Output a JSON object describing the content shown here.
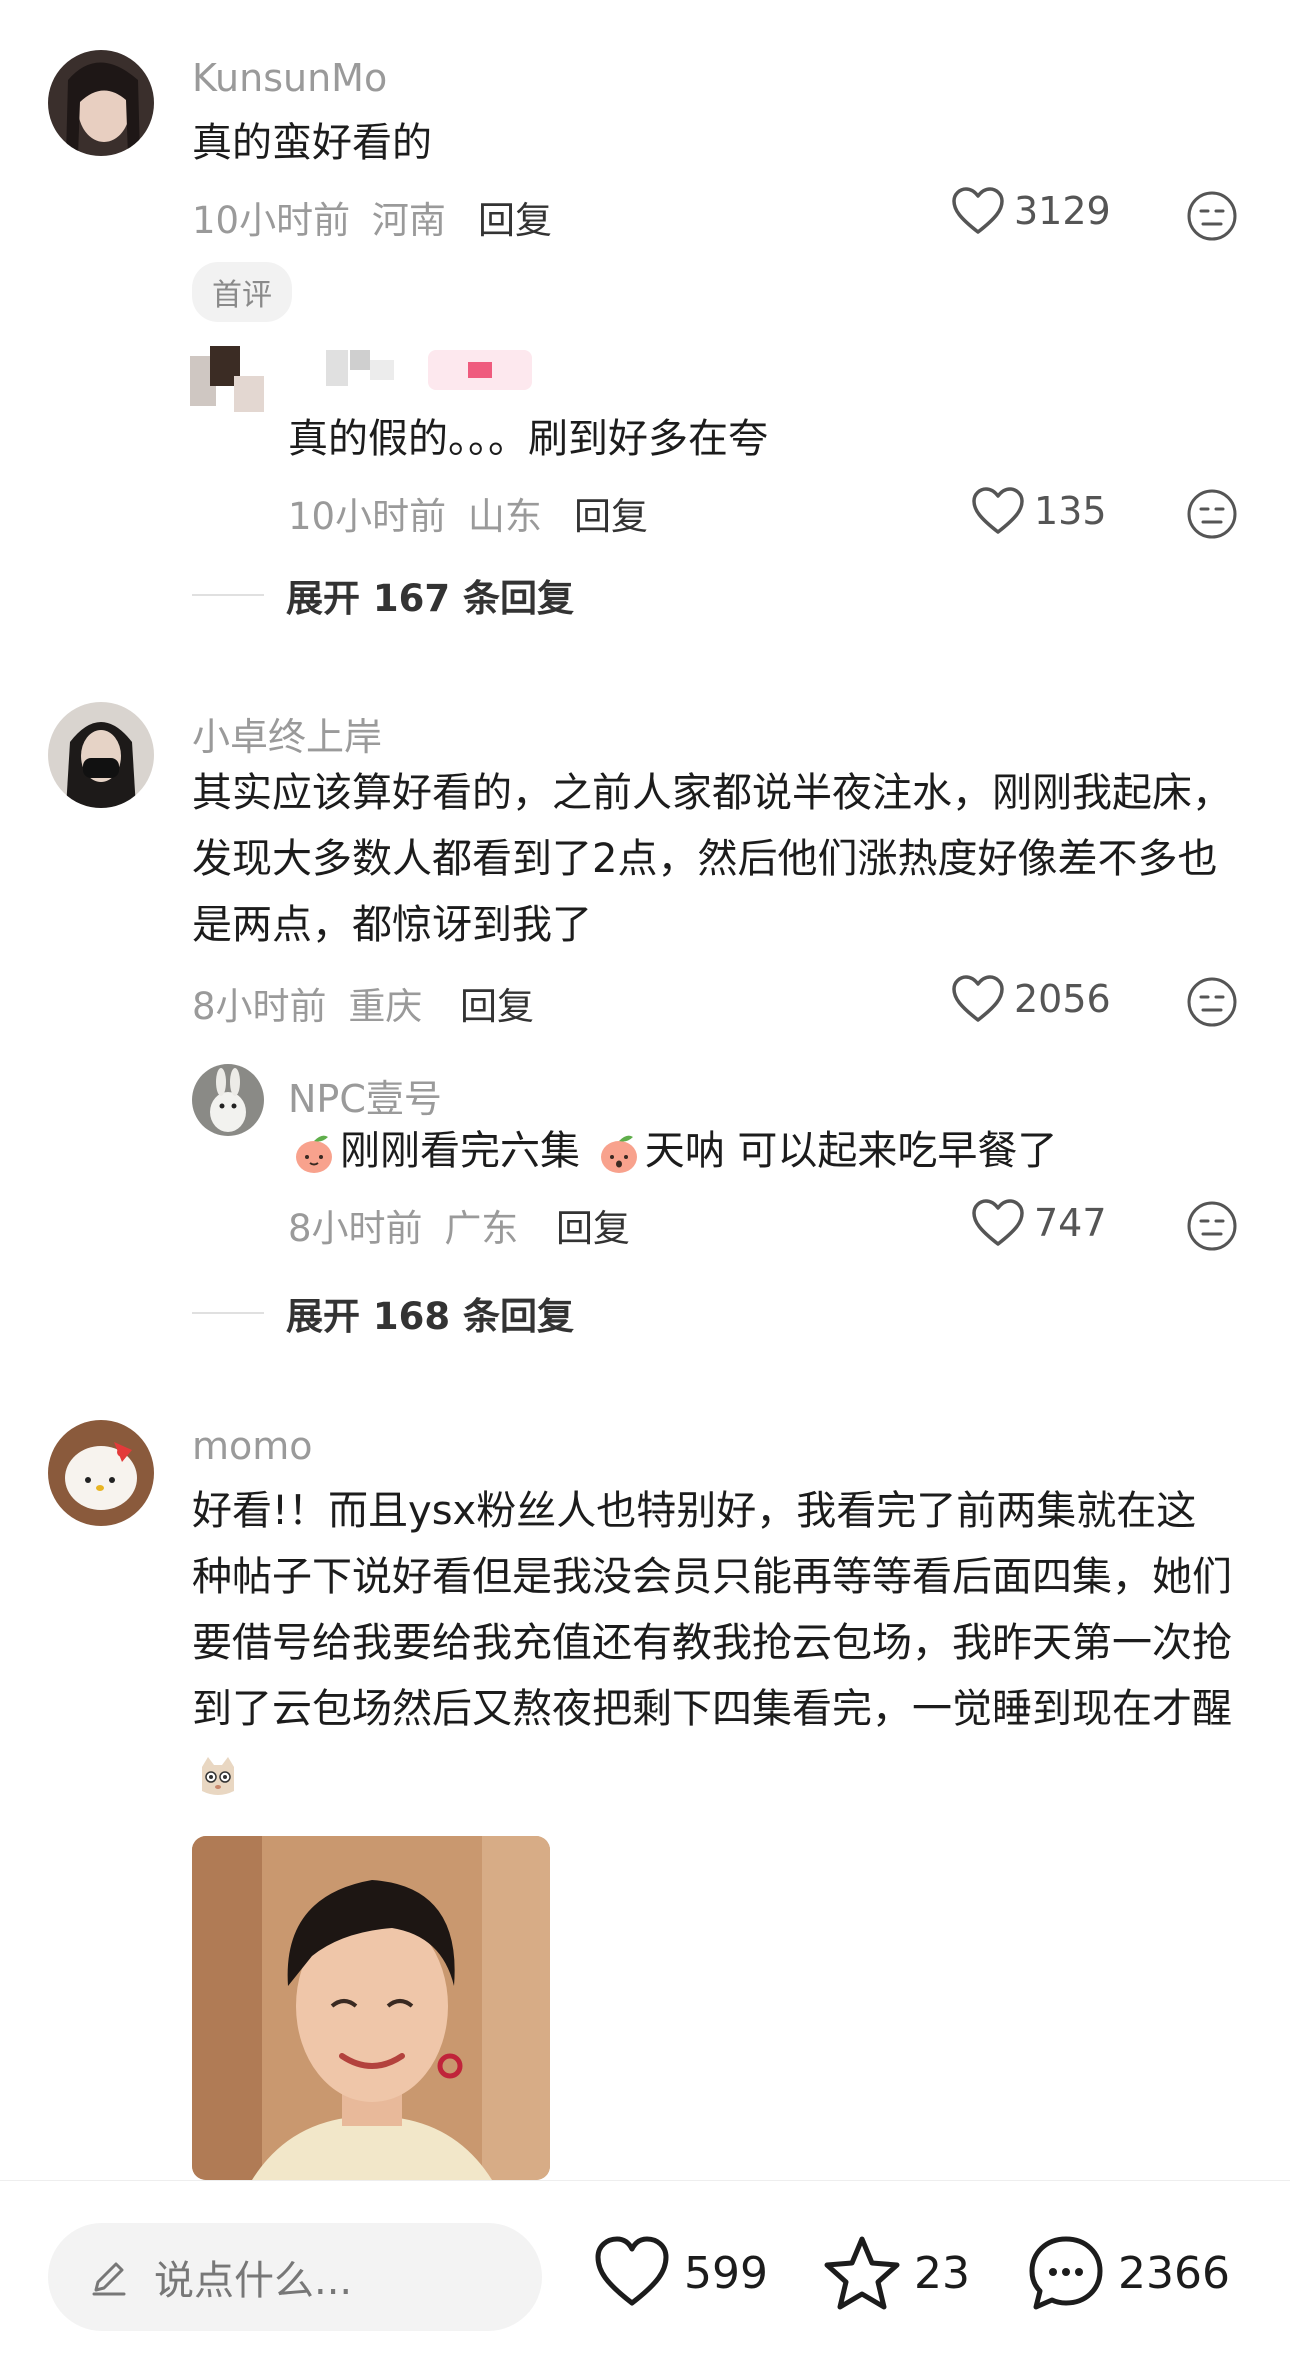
{
  "comments": [
    {
      "username": "KunsunMo",
      "text": "真的蛮好看的",
      "time": "10小时前",
      "location": "河南",
      "reply_label": "回复",
      "likes": "3129",
      "badge": "首评",
      "replies": [
        {
          "username": "",
          "text": "真的假的。。。刷到好多在夸",
          "time": "10小时前",
          "location": "山东",
          "reply_label": "回复",
          "likes": "135"
        }
      ],
      "expand_label": "展开 167 条回复"
    },
    {
      "username": "小卓终上岸",
      "text": "其实应该算好看的，之前人家都说半夜注水，刚刚我起床，发现大多数人都看到了2点，然后他们涨热度好像差不多也是两点，都惊讶到我了",
      "time": "8小时前",
      "location": "重庆",
      "reply_label": "回复",
      "likes": "2056",
      "replies": [
        {
          "username": "NPC壹号",
          "text_part1": "刚刚看完六集",
          "text_part2": "天呐 可以起来吃早餐了",
          "time": "8小时前",
          "location": "广东",
          "reply_label": "回复",
          "likes": "747"
        }
      ],
      "expand_label": "展开 168 条回复"
    },
    {
      "username": "momo",
      "text": "好看!！而且ysx粉丝人也特别好，我看完了前两集就在这种帖子下说好看但是我没会员只能再等等看后面四集，她们要借号给我要给我充值还有教我抢云包场，我昨天第一次抢到了云包场然后又熬夜把剩下四集看完，一觉睡到现在才醒"
    }
  ],
  "bottom_bar": {
    "input_placeholder": "说点什么...",
    "likes": "599",
    "favorites": "23",
    "comments": "2366"
  },
  "icons": {
    "like": "heart-outline-icon",
    "dislike": "neutral-face-icon",
    "favorite": "star-outline-icon",
    "comment": "speech-bubble-icon",
    "compose": "pencil-icon"
  },
  "colors": {
    "username": "#9a9a9a",
    "text": "#1c1c1c",
    "meta": "#9a9a9a"
  }
}
